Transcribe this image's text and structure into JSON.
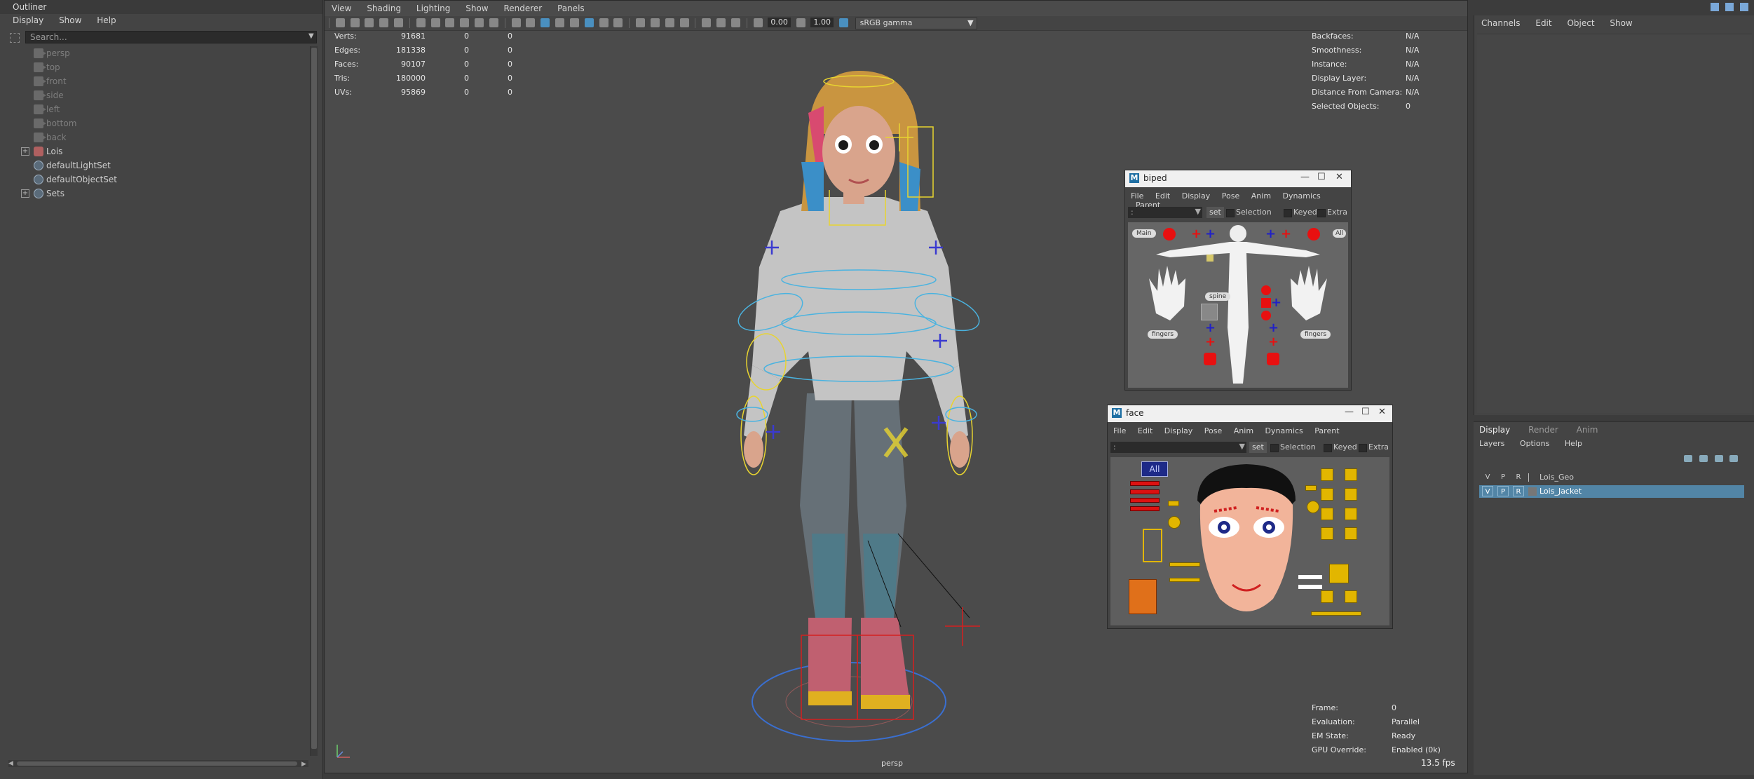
{
  "outliner": {
    "title": "Outliner",
    "menu": [
      "Display",
      "Show",
      "Help"
    ],
    "search_placeholder": "Search...",
    "nodes": [
      {
        "label": "persp",
        "type": "camera",
        "dim": true
      },
      {
        "label": "top",
        "type": "camera",
        "dim": true
      },
      {
        "label": "front",
        "type": "camera",
        "dim": true
      },
      {
        "label": "side",
        "type": "camera",
        "dim": true
      },
      {
        "label": "left",
        "type": "camera",
        "dim": true
      },
      {
        "label": "bottom",
        "type": "camera",
        "dim": true
      },
      {
        "label": "back",
        "type": "camera",
        "dim": true
      },
      {
        "label": "Lois",
        "type": "group",
        "expandable": true
      },
      {
        "label": "defaultLightSet",
        "type": "set"
      },
      {
        "label": "defaultObjectSet",
        "type": "set"
      },
      {
        "label": "Sets",
        "type": "set",
        "expandable": true
      }
    ]
  },
  "viewport": {
    "menu": [
      "View",
      "Shading",
      "Lighting",
      "Show",
      "Renderer",
      "Panels"
    ],
    "exposure": "0.00",
    "gamma": "1.00",
    "colorspace": "sRGB gamma",
    "camera": "persp",
    "fps": "13.5 fps",
    "hud_stats": [
      {
        "k": "Verts:",
        "a": "91681",
        "b": "0",
        "c": "0"
      },
      {
        "k": "Edges:",
        "a": "181338",
        "b": "0",
        "c": "0"
      },
      {
        "k": "Faces:",
        "a": "90107",
        "b": "0",
        "c": "0"
      },
      {
        "k": "Tris:",
        "a": "180000",
        "b": "0",
        "c": "0"
      },
      {
        "k": "UVs:",
        "a": "95869",
        "b": "0",
        "c": "0"
      }
    ],
    "hud_info": [
      {
        "k": "Backfaces:",
        "v": "N/A"
      },
      {
        "k": "Smoothness:",
        "v": "N/A"
      },
      {
        "k": "Instance:",
        "v": "N/A"
      },
      {
        "k": "Display Layer:",
        "v": "N/A"
      },
      {
        "k": "Distance From Camera:",
        "v": "N/A"
      },
      {
        "k": "Selected Objects:",
        "v": "0"
      }
    ],
    "hud_frame": [
      {
        "k": "Frame:",
        "v": "0"
      },
      {
        "k": "Evaluation:",
        "v": "Parallel"
      },
      {
        "k": "EM State:",
        "v": "Ready"
      },
      {
        "k": "GPU Override:",
        "v": "Enabled (0k)"
      }
    ]
  },
  "biped": {
    "title": "biped",
    "menu": [
      "File",
      "Edit",
      "Display",
      "Pose",
      "Anim",
      "Dynamics",
      "Parent"
    ],
    "combo": ":",
    "set": "set",
    "checks": [
      "Selection",
      "Keyed",
      "Extra"
    ],
    "buttons": {
      "main": "Main",
      "all": "All",
      "spine": "spine",
      "fingers": "fingers"
    }
  },
  "face": {
    "title": "face",
    "menu": [
      "File",
      "Edit",
      "Display",
      "Pose",
      "Anim",
      "Dynamics",
      "Parent"
    ],
    "combo": ":",
    "set": "set",
    "checks": [
      "Selection",
      "Keyed",
      "Extra"
    ],
    "all": "All"
  },
  "channelbox": {
    "menu": [
      "Channels",
      "Edit",
      "Object",
      "Show"
    ]
  },
  "layers": {
    "tabs": [
      "Display",
      "Render",
      "Anim"
    ],
    "menu": [
      "Layers",
      "Options",
      "Help"
    ],
    "header": {
      "v": "V",
      "p": "P",
      "r": "R",
      "name": "Lois_Geo"
    },
    "rows": [
      {
        "v": "V",
        "p": "P",
        "r": "R",
        "name": "Lois_Jacket",
        "selected": true
      }
    ]
  },
  "colors": {
    "accent": "#5285a6",
    "wire_yellow": "#e8d430",
    "wire_cyan": "#4ab3e0",
    "wire_red": "#d42020",
    "ctrl_blue": "#3a3ad0"
  }
}
